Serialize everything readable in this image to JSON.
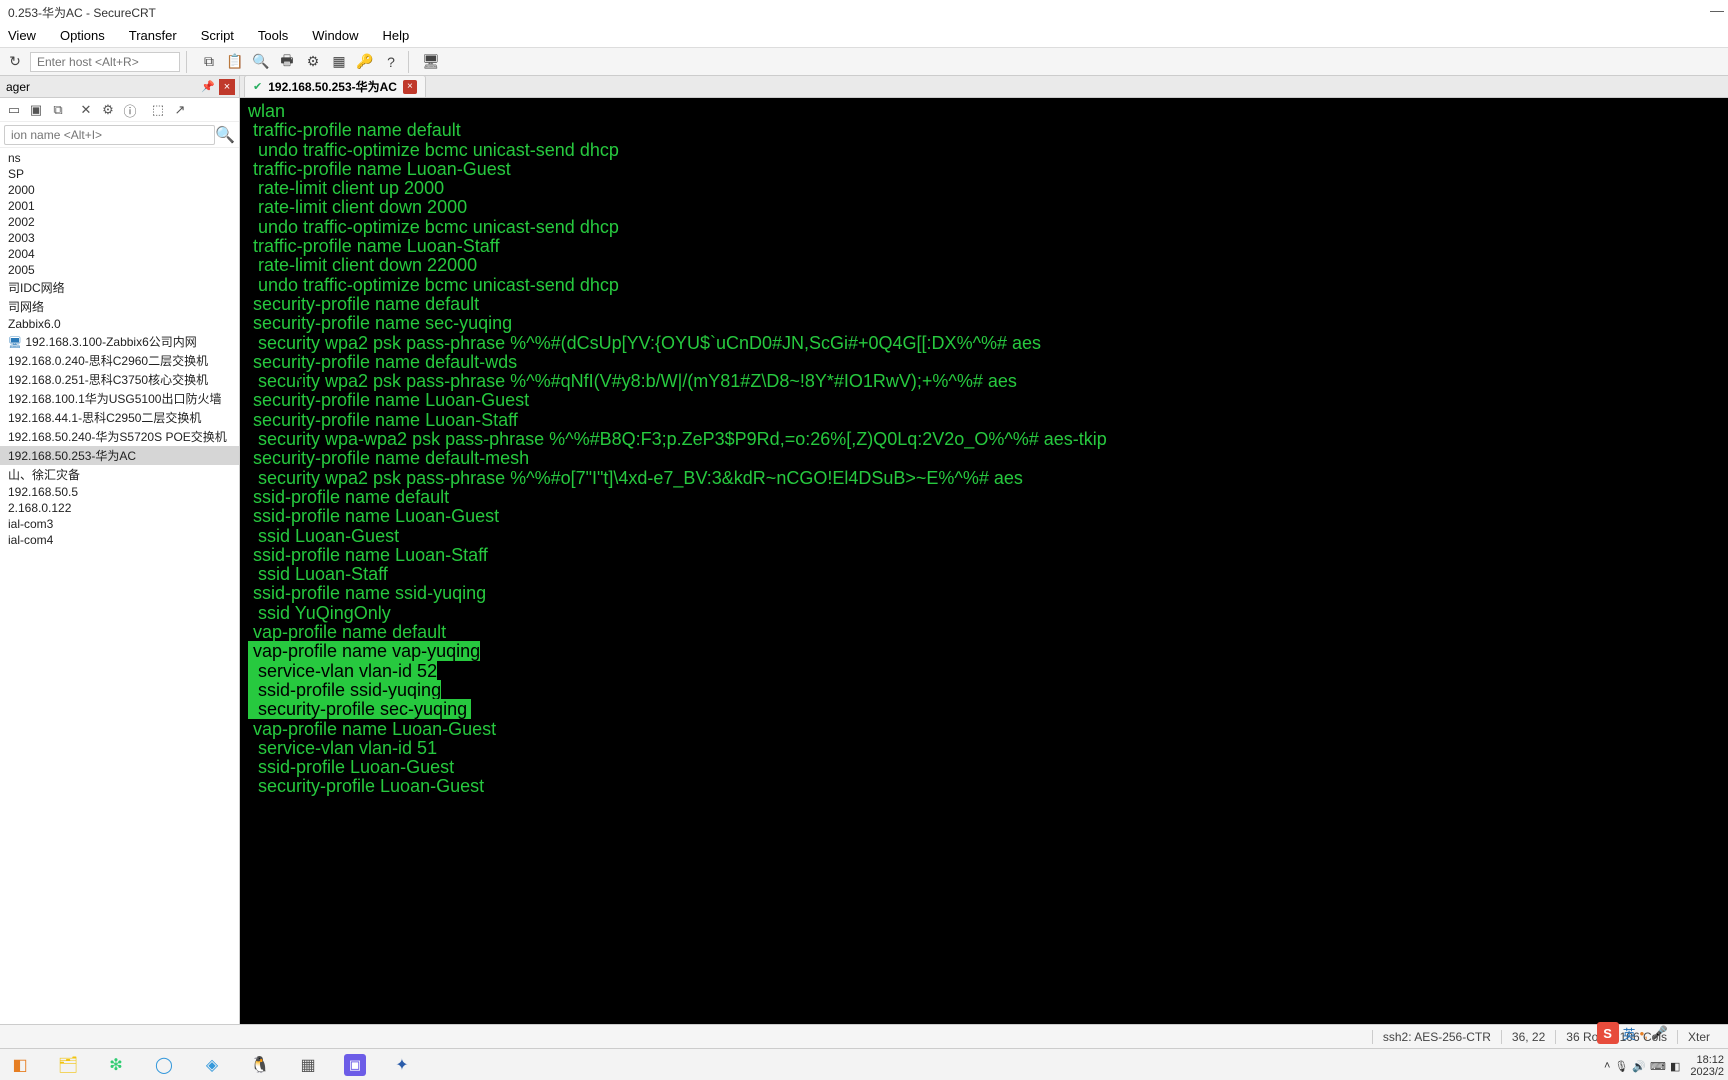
{
  "window": {
    "title": "0.253-华为AC - SecureCRT",
    "minimize": "—"
  },
  "menu": {
    "view": "View",
    "options": "Options",
    "transfer": "Transfer",
    "script": "Script",
    "tools": "Tools",
    "window": "Window",
    "help": "Help"
  },
  "toolbar": {
    "host_placeholder": "Enter host <Alt+R>"
  },
  "sidebar": {
    "header": "ager",
    "filter_placeholder": "ion name <Alt+I>",
    "nodes": [
      {
        "label": "ns"
      },
      {
        "label": "SP"
      },
      {
        "label": "2000"
      },
      {
        "label": "2001"
      },
      {
        "label": "2002"
      },
      {
        "label": "2003"
      },
      {
        "label": "2004"
      },
      {
        "label": "2005"
      },
      {
        "label": "司IDC网络"
      },
      {
        "label": "司网络"
      },
      {
        "label": "Zabbix6.0"
      },
      {
        "label": "192.168.3.100-Zabbix6公司内网",
        "icon": true
      },
      {
        "label": "192.168.0.240-思科C2960二层交换机"
      },
      {
        "label": "192.168.0.251-思科C3750核心交换机"
      },
      {
        "label": "192.168.100.1华为USG5100出口防火墙"
      },
      {
        "label": "192.168.44.1-思科C2950二层交换机"
      },
      {
        "label": "192.168.50.240-华为S5720S POE交换机"
      },
      {
        "label": "192.168.50.253-华为AC",
        "sel": true
      },
      {
        "label": "山、徐汇灾备"
      },
      {
        "label": "192.168.50.5"
      },
      {
        "label": "2.168.0.122"
      },
      {
        "label": "ial-com3"
      },
      {
        "label": "ial-com4"
      }
    ]
  },
  "tab": {
    "title": "192.168.50.253-华为AC"
  },
  "terminal_lines": [
    {
      "t": "wlan",
      "i": 0
    },
    {
      "t": " traffic-profile name default",
      "i": 0
    },
    {
      "t": "  undo traffic-optimize bcmc unicast-send dhcp",
      "i": 0
    },
    {
      "t": " traffic-profile name Luoan-Guest",
      "i": 0
    },
    {
      "t": "  rate-limit client up 2000",
      "i": 0
    },
    {
      "t": "  rate-limit client down 2000",
      "i": 0
    },
    {
      "t": "  undo traffic-optimize bcmc unicast-send dhcp",
      "i": 0
    },
    {
      "t": " traffic-profile name Luoan-Staff",
      "i": 0
    },
    {
      "t": "  rate-limit client down 22000",
      "i": 0
    },
    {
      "t": "  undo traffic-optimize bcmc unicast-send dhcp",
      "i": 0
    },
    {
      "t": " security-profile name default",
      "i": 0
    },
    {
      "t": " security-profile name sec-yuqing",
      "i": 0
    },
    {
      "t": "  security wpa2 psk pass-phrase %^%#(dCsUp[YV:{OYU$`uCnD0#JN,ScGi#+0Q4G[[:DX%^%# aes",
      "i": 0
    },
    {
      "t": " security-profile name default-wds",
      "i": 0
    },
    {
      "t": "  security wpa2 psk pass-phrase %^%#qNfI(V#y8:b/W|/(mY81#Z\\D8~!8Y*#IO1RwV);+%^%# aes",
      "i": 0
    },
    {
      "t": " security-profile name Luoan-Guest",
      "i": 0
    },
    {
      "t": " security-profile name Luoan-Staff",
      "i": 0
    },
    {
      "t": "  security wpa-wpa2 psk pass-phrase %^%#B8Q:F3;p.ZeP3$P9Rd,=o:26%[,Z)Q0Lq:2V2o_O%^%# aes-tkip",
      "i": 0
    },
    {
      "t": " security-profile name default-mesh",
      "i": 0
    },
    {
      "t": "  security wpa2 psk pass-phrase %^%#o[7\"I\"t]\\4xd-e7_BV:3&kdR~nCGO!El4DSuB>~E%^%# aes",
      "i": 0
    },
    {
      "t": " ssid-profile name default",
      "i": 0
    },
    {
      "t": " ssid-profile name Luoan-Guest",
      "i": 0
    },
    {
      "t": "  ssid Luoan-Guest",
      "i": 0
    },
    {
      "t": " ssid-profile name Luoan-Staff",
      "i": 0
    },
    {
      "t": "  ssid Luoan-Staff",
      "i": 0
    },
    {
      "t": " ssid-profile name ssid-yuqing",
      "i": 0
    },
    {
      "t": "  ssid YuQingOnly",
      "i": 0
    },
    {
      "t": " vap-profile name default",
      "i": 0
    },
    {
      "t": " vap-profile name vap-yuqing",
      "i": 0,
      "sel": true
    },
    {
      "t": "  service-vlan vlan-id 52",
      "i": 0,
      "sel": true
    },
    {
      "t": "  ssid-profile ssid-yuqing",
      "i": 0,
      "sel": true
    },
    {
      "t": "  security-profile sec-yuqing",
      "i": 0,
      "sel": true,
      "last": true
    },
    {
      "t": " vap-profile name Luoan-Guest",
      "i": 0
    },
    {
      "t": "  service-vlan vlan-id 51",
      "i": 0
    },
    {
      "t": "  ssid-profile Luoan-Guest",
      "i": 0
    },
    {
      "t": "  security-profile Luoan-Guest",
      "i": 0
    }
  ],
  "status": {
    "proto": "ssh2: AES-256-CTR",
    "cursor": "36,  22",
    "size": "36 Rows, 106 Cols",
    "term": "Xter"
  },
  "ime_cn": "英",
  "clock": {
    "time": "18:12",
    "date": "2023/2"
  }
}
